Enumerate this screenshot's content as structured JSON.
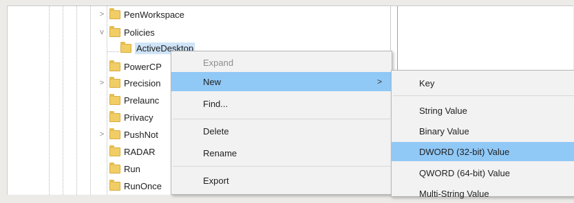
{
  "tree": {
    "items": [
      {
        "label": "PenWorkspace",
        "chevron": ">"
      },
      {
        "label": "Policies",
        "chevron": "v"
      },
      {
        "label": "ActiveDesktop",
        "chevron": ""
      },
      {
        "label": "PowerCP",
        "chevron": ""
      },
      {
        "label": "Precision",
        "chevron": ">"
      },
      {
        "label": "Prelaunc",
        "chevron": ""
      },
      {
        "label": "Privacy",
        "chevron": ""
      },
      {
        "label": "PushNot",
        "chevron": ">"
      },
      {
        "label": "RADAR",
        "chevron": ""
      },
      {
        "label": "Run",
        "chevron": ""
      },
      {
        "label": "RunOnce",
        "chevron": ""
      }
    ]
  },
  "context_menu": {
    "items": [
      {
        "label": "Expand",
        "disabled": true
      },
      {
        "label": "New",
        "arrow": ">"
      },
      {
        "label": "Find..."
      },
      {
        "label": "Delete"
      },
      {
        "label": "Rename"
      },
      {
        "label": "Export"
      }
    ]
  },
  "new_submenu": {
    "items": [
      {
        "label": "Key"
      },
      {
        "label": "String Value"
      },
      {
        "label": "Binary Value"
      },
      {
        "label": "DWORD (32-bit) Value"
      },
      {
        "label": "QWORD (64-bit) Value"
      },
      {
        "label": "Multi-String Value"
      }
    ]
  },
  "colors": {
    "highlight": "#90c8f6",
    "folder": "#f1cd66",
    "menu_bg": "#f2f2f2"
  }
}
